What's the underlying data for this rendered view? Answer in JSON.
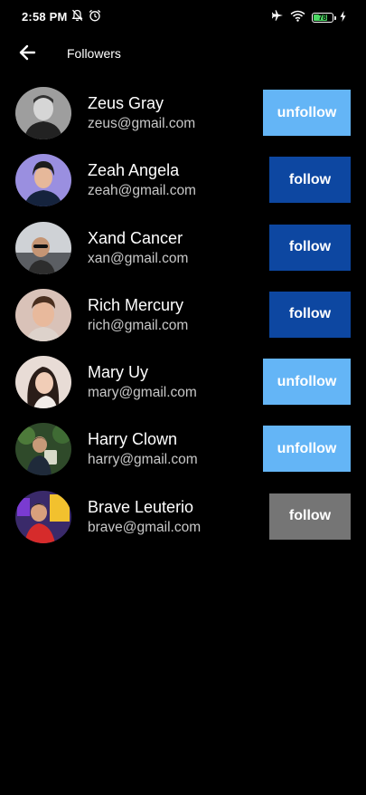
{
  "status_bar": {
    "time": "2:58 PM",
    "battery_level": "78",
    "battery_color": "#4cd964",
    "left_icons": [
      "bell-off-icon",
      "alarm-icon"
    ],
    "right_icons": [
      "airplane-icon",
      "wifi-icon",
      "battery-icon",
      "charging-icon"
    ]
  },
  "app_bar": {
    "back_icon": "arrow-left-icon",
    "title": "Followers"
  },
  "followers": [
    {
      "name": "Zeus Gray",
      "email": "zeus@gmail.com",
      "button_label": "unfollow",
      "button_color": "#64b5f6"
    },
    {
      "name": "Zeah Angela",
      "email": "zeah@gmail.com",
      "button_label": "follow",
      "button_color": "#0d47a1"
    },
    {
      "name": "Xand Cancer",
      "email": "xan@gmail.com",
      "button_label": "follow",
      "button_color": "#0d47a1"
    },
    {
      "name": "Rich Mercury",
      "email": "rich@gmail.com",
      "button_label": "follow",
      "button_color": "#0d47a1"
    },
    {
      "name": "Mary Uy",
      "email": "mary@gmail.com",
      "button_label": "unfollow",
      "button_color": "#64b5f6"
    },
    {
      "name": "Harry Clown",
      "email": "harry@gmail.com",
      "button_label": "unfollow",
      "button_color": "#64b5f6"
    },
    {
      "name": "Brave Leuterio",
      "email": "brave@gmail.com",
      "button_label": "follow",
      "button_color": "#757575"
    }
  ]
}
